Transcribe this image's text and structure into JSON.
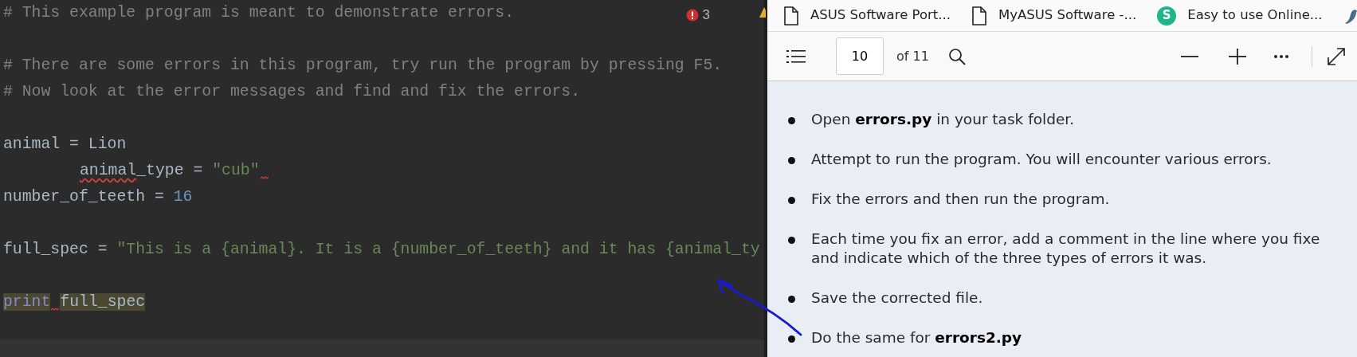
{
  "editor": {
    "lines": [
      {
        "kind": "code",
        "segments": [
          {
            "text": "# This example program is meant to demonstrate errors.",
            "kind": "comment"
          }
        ]
      },
      {
        "kind": "blank"
      },
      {
        "kind": "code",
        "segments": [
          {
            "text": "# There are some errors in this program, try run the program by pressing F5.",
            "kind": "comment"
          }
        ]
      },
      {
        "kind": "code",
        "segments": [
          {
            "text": "# Now look at the error messages and find and fix the errors.",
            "kind": "comment"
          }
        ]
      },
      {
        "kind": "blank"
      },
      {
        "kind": "code",
        "segments": [
          {
            "text": "animal = Lion",
            "kind": "ident"
          }
        ]
      },
      {
        "kind": "code",
        "indented": true,
        "segments": [
          {
            "text": "animal",
            "kind": "ident",
            "squiggle": true
          },
          {
            "text": "_type = ",
            "kind": "ident"
          },
          {
            "text": "\"cub\"",
            "kind": "string",
            "squiggle_after": true
          }
        ]
      },
      {
        "kind": "code",
        "segments": [
          {
            "text": "number_of_teeth = ",
            "kind": "ident"
          },
          {
            "text": "16",
            "kind": "number"
          }
        ]
      },
      {
        "kind": "blank"
      },
      {
        "kind": "code",
        "segments": [
          {
            "text": "full_spec = ",
            "kind": "ident"
          },
          {
            "text": "\"This is a {animal}. It is a {number_of_teeth} and it has {animal_ty",
            "kind": "string"
          }
        ]
      },
      {
        "kind": "blank"
      },
      {
        "kind": "code",
        "segments": [
          {
            "text": "print",
            "kind": "keyword",
            "highlight": true,
            "squiggle_after": true
          },
          {
            "text": "full_spec",
            "kind": "ident",
            "highlight": true
          }
        ]
      }
    ],
    "error_count": "3"
  },
  "viewer": {
    "bookmarks": [
      {
        "kind": "document",
        "label": "ASUS Software Port..."
      },
      {
        "kind": "document",
        "label": "MyASUS Software -..."
      },
      {
        "kind": "letter",
        "letter": "S",
        "color": "#1db58a",
        "label": "Easy to use Online..."
      },
      {
        "kind": "bird"
      }
    ],
    "page_number": "10",
    "page_total": "of 11",
    "steps": [
      {
        "lines": [
          "Open **errors.py** in your task folder."
        ]
      },
      {
        "lines": [
          "Attempt to run the program. You will encounter various errors."
        ]
      },
      {
        "lines": [
          "Fix the errors and then run the program."
        ]
      },
      {
        "lines": [
          "Each time you fix an error, add a comment in the line where you fixe",
          "and indicate which of the three types of errors it was."
        ]
      },
      {
        "lines": [
          "Save the corrected file."
        ]
      },
      {
        "lines": [
          "Do the same for **errors2.py**"
        ]
      }
    ]
  }
}
